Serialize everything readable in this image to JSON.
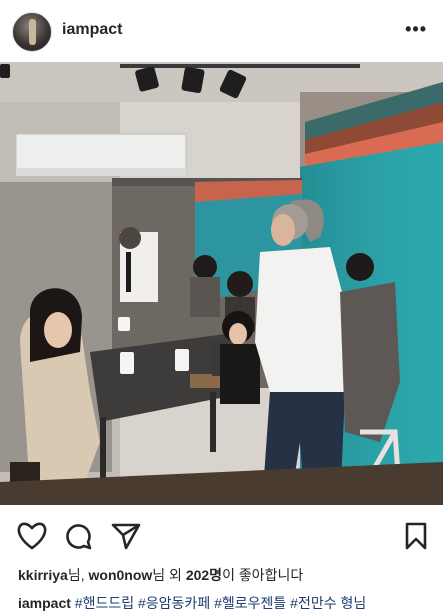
{
  "post": {
    "username": "iampact",
    "more_label": "•••"
  },
  "likes": {
    "liker1": "kkirriya",
    "sep1": "님, ",
    "liker2": "won0now",
    "sep2": "님 외 ",
    "count": "202명",
    "suffix": "이 좋아합니다"
  },
  "caption": {
    "username": "iampact",
    "text": " #핸드드립 #응암동카페 #헬로우젠틀 #전만수 형님"
  },
  "icons": {
    "like": "heart-icon",
    "comment": "comment-icon",
    "share": "share-icon",
    "save": "bookmark-icon",
    "more": "more-icon"
  }
}
